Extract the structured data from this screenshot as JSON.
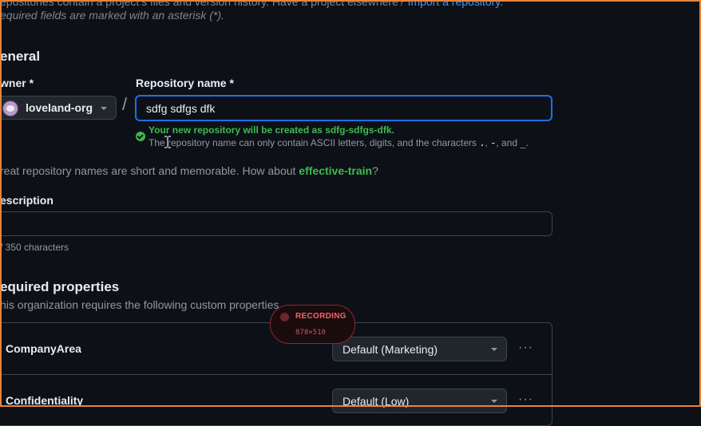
{
  "intro": {
    "text": "epositories contain a project's files and version history. Have a project elsewhere? ",
    "link": "Import a repository.",
    "required_note": "equired fields are marked with an asterisk (*)."
  },
  "general": {
    "heading": "eneral",
    "owner_label": "wner *",
    "owner_value": "loveland-org",
    "slash": "/",
    "repo_label": "Repository name *",
    "repo_value": "sdfg sdfgs dfk",
    "success_msg": "Your new repository will be created as sdfg-sdfgs-dfk.",
    "hint_prefix": "The repository name can only contain ASCII letters, digits, and the characters ",
    "hint_chars": [
      ".",
      "-",
      "_"
    ],
    "hint_sep1": ", ",
    "hint_sep2": ", and ",
    "hint_end": ".",
    "suggestion_prefix": "reat repository names are short and memorable. How about ",
    "suggestion_name": "effective-train",
    "suggestion_suffix": "?"
  },
  "description": {
    "label": "escription",
    "value": "",
    "char_count": "/ 350 characters"
  },
  "properties": {
    "heading": "equired properties",
    "desc": "his organization requires the following custom properties",
    "items": [
      {
        "name": "CompanyArea",
        "value": "Default (Marketing)",
        "menu": "···"
      },
      {
        "name": "Confidentiality",
        "value": "Default (Low)",
        "menu": "···"
      }
    ]
  },
  "recording": {
    "label": "RECORDING",
    "size": "878×510"
  },
  "colors": {
    "accent": "#1f6feb",
    "success": "#3fb950",
    "recording": "#f0646a",
    "frame": "#e8833a"
  },
  "icons": {
    "owner_caret": "chevron-down-icon",
    "success": "check-circle-icon",
    "cursor": "text-cursor-icon",
    "kebab": "kebab-horizontal-icon"
  }
}
